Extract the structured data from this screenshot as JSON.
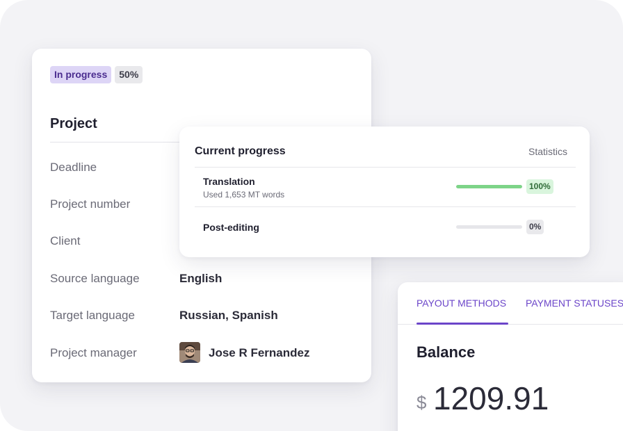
{
  "project": {
    "status_badge": "In progress",
    "percent_badge": "50%",
    "title": "Project",
    "details": [
      {
        "label": "Deadline",
        "value": ""
      },
      {
        "label": "Project number",
        "value": ""
      },
      {
        "label": "Client",
        "value": ""
      },
      {
        "label": "Source language",
        "value": "English"
      },
      {
        "label": "Target language",
        "value": "Russian, Spanish"
      },
      {
        "label": "Project manager",
        "value": "Jose R Fernandez"
      }
    ]
  },
  "progress": {
    "title": "Current progress",
    "statistics_label": "Statistics",
    "rows": [
      {
        "title": "Translation",
        "subtitle": "Used 1,653 MT words",
        "percent_label": "100%",
        "progress": 1.0
      },
      {
        "title": "Post-editing",
        "subtitle": "",
        "percent_label": "0%",
        "progress": 0.0
      }
    ]
  },
  "balance": {
    "tabs": [
      {
        "label": "PAYOUT METHODS",
        "active": true
      },
      {
        "label": "PAYMENT STATUSES",
        "active": false
      }
    ],
    "title": "Balance",
    "currency": "$",
    "amount": "1209.91"
  },
  "colors": {
    "accent": "#6b45c9",
    "progress_green": "#7dd488",
    "status_badge_bg": "#ddd5f6"
  },
  "icons": {
    "avatar": "person-avatar"
  }
}
